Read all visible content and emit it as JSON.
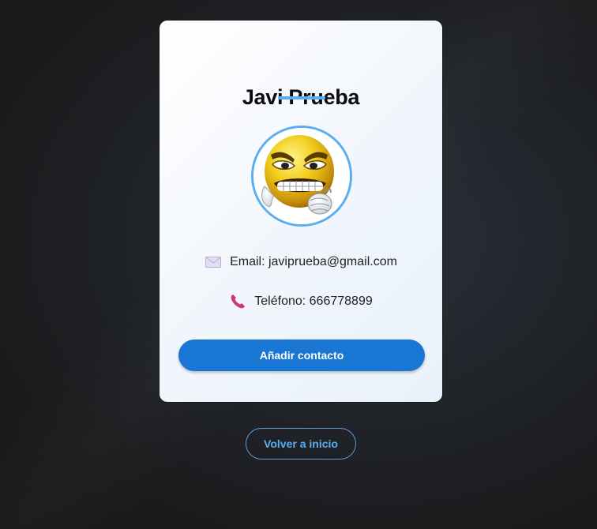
{
  "profile": {
    "name": "Javi Prueba",
    "avatar_icon": "angry-emoji-avatar",
    "email_icon": "envelope-icon",
    "email_text": "Email: javiprueba@gmail.com",
    "phone_icon": "phone-icon",
    "phone_text": "Teléfono: 666778899"
  },
  "actions": {
    "add_contact": "Añadir contacto",
    "back_home": "Volver a inicio"
  },
  "colors": {
    "accent": "#5aaef0",
    "primary_button": "#1976d2",
    "secondary_text": "#5aaef0",
    "phone_icon": "#d0357a"
  }
}
